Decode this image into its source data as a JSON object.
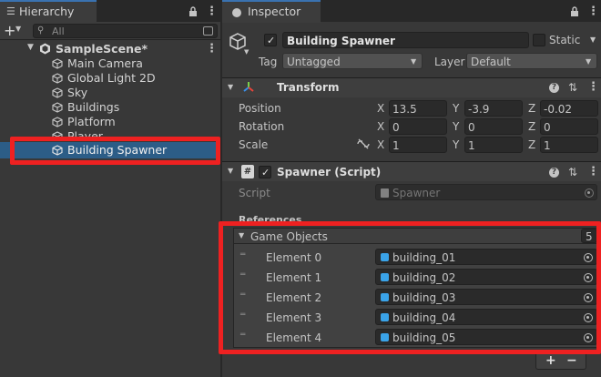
{
  "hierarchy": {
    "tab_title": "Hierarchy",
    "add_label": "+",
    "search_placeholder": "All",
    "scene_name": "SampleScene*",
    "items": [
      {
        "label": "Main Camera"
      },
      {
        "label": "Global Light 2D"
      },
      {
        "label": "Sky"
      },
      {
        "label": "Buildings"
      },
      {
        "label": "Platform"
      },
      {
        "label": "Player"
      },
      {
        "label": "Building Spawner"
      }
    ]
  },
  "inspector": {
    "tab_title": "Inspector",
    "object_name": "Building Spawner",
    "static_label": "Static",
    "tag_label": "Tag",
    "tag_value": "Untagged",
    "layer_label": "Layer",
    "layer_value": "Default",
    "transform": {
      "title": "Transform",
      "rows": [
        {
          "label": "Position",
          "x": "13.5",
          "y": "-3.9",
          "z": "-0.02"
        },
        {
          "label": "Rotation",
          "x": "0",
          "y": "0",
          "z": "0"
        },
        {
          "label": "Scale",
          "x": "1",
          "y": "1",
          "z": "1"
        }
      ],
      "axis_x": "X",
      "axis_y": "Y",
      "axis_z": "Z"
    },
    "spawner": {
      "title": "Spawner (Script)",
      "script_label": "Script",
      "script_value": "Spawner",
      "references_label": "References",
      "list_label": "Game Objects",
      "list_count": "5",
      "elements": [
        {
          "label": "Element 0",
          "value": "building_01"
        },
        {
          "label": "Element 1",
          "value": "building_02"
        },
        {
          "label": "Element 2",
          "value": "building_03"
        },
        {
          "label": "Element 3",
          "value": "building_04"
        },
        {
          "label": "Element 4",
          "value": "building_05"
        }
      ],
      "add_label": "+",
      "remove_label": "−"
    }
  },
  "colors": {
    "highlight": "#ee2121",
    "selection": "#2c5d87",
    "accent": "#3a72b0"
  }
}
